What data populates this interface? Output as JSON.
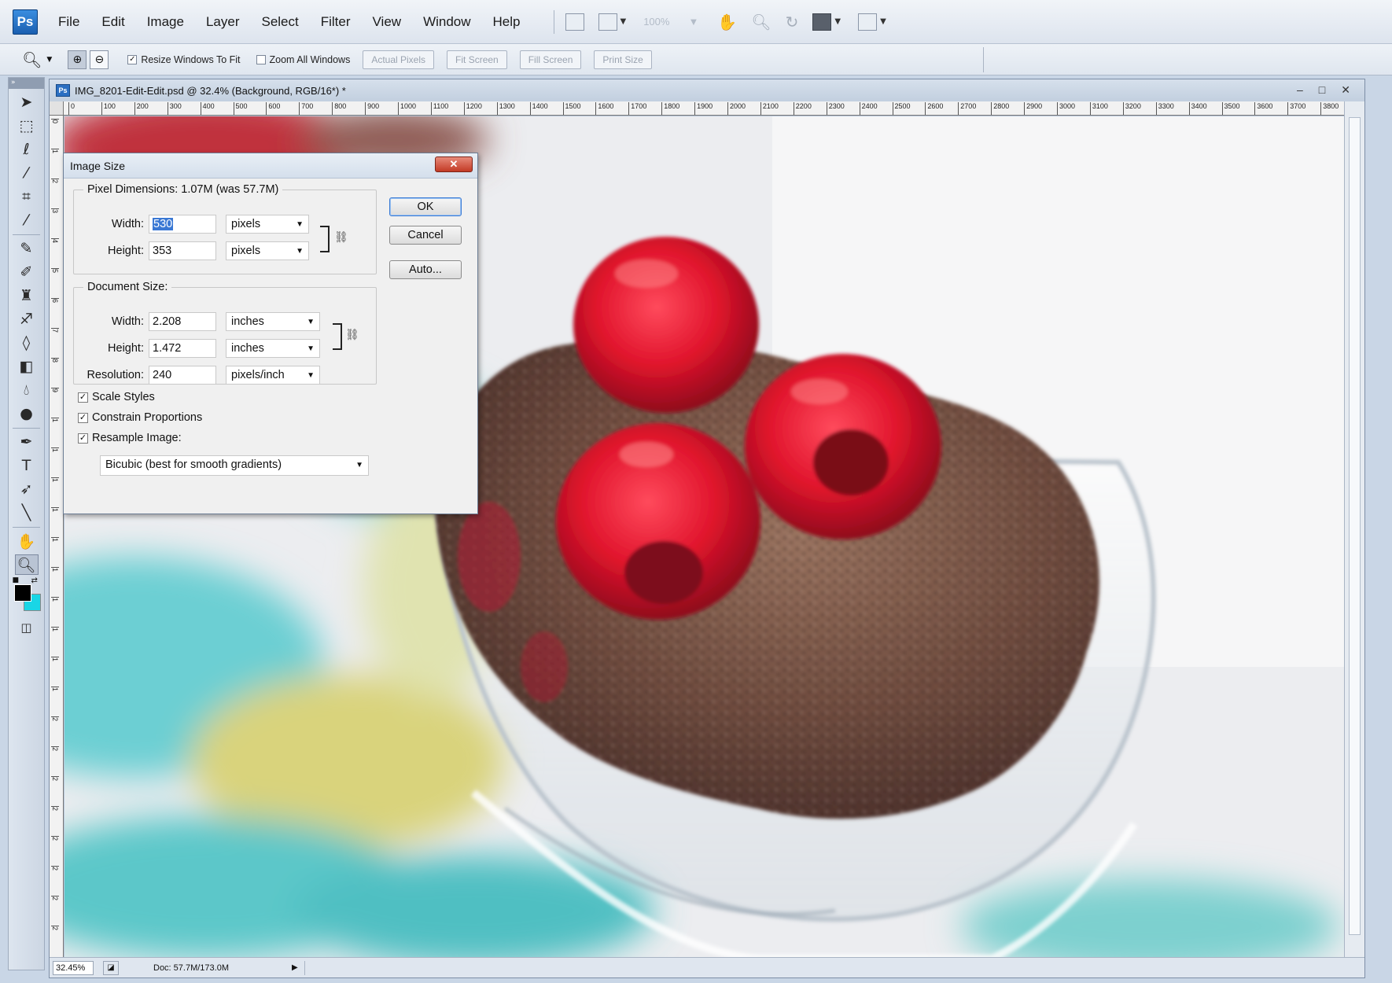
{
  "app": {
    "logo": "Ps",
    "menu": [
      "File",
      "Edit",
      "Image",
      "Layer",
      "Select",
      "Filter",
      "View",
      "Window",
      "Help"
    ],
    "zoom_level_dim": "100%"
  },
  "options_bar": {
    "resize_windows_label": "Resize Windows To Fit",
    "zoom_all_label": "Zoom All Windows",
    "buttons": [
      "Actual Pixels",
      "Fit Screen",
      "Fill Screen",
      "Print Size"
    ]
  },
  "document": {
    "title": "IMG_8201-Edit-Edit.psd @ 32.4% (Background, RGB/16*) *",
    "ruler_top": [
      "0",
      "100",
      "200",
      "300",
      "400",
      "500",
      "600",
      "700",
      "800",
      "900",
      "1000",
      "1100",
      "1200",
      "1300",
      "1400",
      "1500",
      "1600",
      "1700",
      "1800",
      "1900",
      "2000",
      "2100",
      "2200",
      "2300",
      "2400",
      "2500",
      "2600",
      "2700",
      "2800",
      "2900",
      "3000",
      "3100",
      "3200",
      "3300",
      "3400",
      "3500",
      "3600",
      "3700",
      "3800"
    ],
    "ruler_left": [
      "0",
      "1",
      "2",
      "3",
      "4",
      "5",
      "6",
      "7",
      "8",
      "9",
      "1",
      "1",
      "1",
      "1",
      "1",
      "1",
      "1",
      "1",
      "1",
      "1",
      "2",
      "2",
      "2",
      "2",
      "2",
      "2",
      "2",
      "2"
    ],
    "status": {
      "zoom": "32.45%",
      "doc_info": "Doc: 57.7M/173.0M"
    }
  },
  "dialog": {
    "title": "Image Size",
    "pixel_dimensions_legend": "Pixel Dimensions:  1.07M (was 57.7M)",
    "pixel_width_label": "Width:",
    "pixel_width_value": "530",
    "pixel_width_unit": "pixels",
    "pixel_height_label": "Height:",
    "pixel_height_value": "353",
    "pixel_height_unit": "pixels",
    "document_size_legend": "Document Size:",
    "doc_width_label": "Width:",
    "doc_width_value": "2.208",
    "doc_width_unit": "inches",
    "doc_height_label": "Height:",
    "doc_height_value": "1.472",
    "doc_height_unit": "inches",
    "resolution_label": "Resolution:",
    "resolution_value": "240",
    "resolution_unit": "pixels/inch",
    "scale_styles_label": "Scale Styles",
    "constrain_label": "Constrain Proportions",
    "resample_label": "Resample Image:",
    "resample_method": "Bicubic (best for smooth gradients)",
    "ok_label": "OK",
    "cancel_label": "Cancel",
    "auto_label": "Auto...",
    "close_glyph": "✕"
  },
  "colors": {
    "foreground": "#000000",
    "background": "#19d6e6",
    "selection": "#3a78d4"
  },
  "icons": {
    "tools": [
      "move-icon",
      "marquee-icon",
      "lasso-icon",
      "magic-wand-icon",
      "crop-icon",
      "eyedropper-icon",
      "healing-brush-icon",
      "brush-icon",
      "clone-stamp-icon",
      "history-brush-icon",
      "eraser-icon",
      "gradient-icon",
      "blur-icon",
      "dodge-icon",
      "pen-icon",
      "type-icon",
      "path-selection-icon",
      "line-icon",
      "hand-icon",
      "zoom-icon"
    ]
  }
}
